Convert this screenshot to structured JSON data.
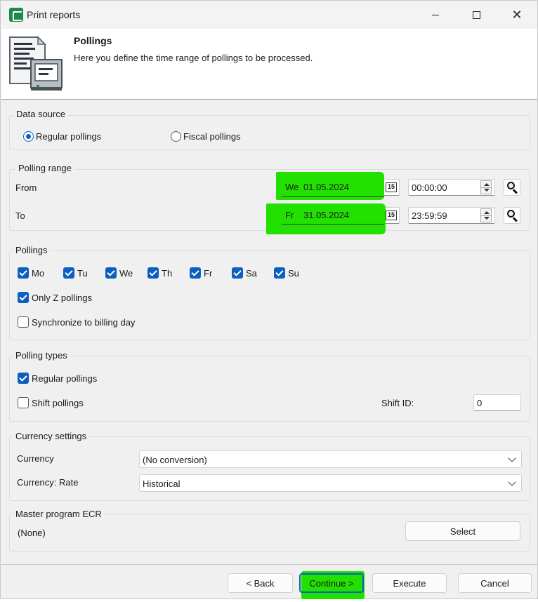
{
  "window": {
    "title": "Print reports"
  },
  "header": {
    "title": "Pollings",
    "subtitle": "Here you define the time range of pollings to be processed."
  },
  "data_source": {
    "title": "Data source",
    "options": [
      {
        "label": "Regular pollings",
        "selected": true
      },
      {
        "label": "Fiscal pollings",
        "selected": false
      }
    ]
  },
  "polling_range": {
    "title": "Polling range",
    "from_label": "From",
    "to_label": "To",
    "from_day": "We",
    "from_date": "01.05.2024",
    "from_time": "00:00:00",
    "to_day": "Fr",
    "to_date": "31.05.2024",
    "to_time": "23:59:59",
    "calendar_glyph": "15",
    "highlight_color": "#22e000"
  },
  "pollings": {
    "title": "Pollings",
    "days": [
      {
        "label": "Mo",
        "checked": true
      },
      {
        "label": "Tu",
        "checked": true
      },
      {
        "label": "We",
        "checked": true
      },
      {
        "label": "Th",
        "checked": true
      },
      {
        "label": "Fr",
        "checked": true
      },
      {
        "label": "Sa",
        "checked": true
      },
      {
        "label": "Su",
        "checked": true
      }
    ],
    "only_z": {
      "label": "Only Z pollings",
      "checked": true
    },
    "sync_billing": {
      "label": "Synchronize to billing day",
      "checked": false
    }
  },
  "polling_types": {
    "title": "Polling types",
    "regular": {
      "label": "Regular pollings",
      "checked": true
    },
    "shift": {
      "label": "Shift pollings",
      "checked": false
    },
    "shift_id_label": "Shift ID:",
    "shift_id_value": "0"
  },
  "currency": {
    "title": "Currency settings",
    "currency_label": "Currency",
    "currency_value": "(No conversion)",
    "rate_label": "Currency: Rate",
    "rate_value": "Historical"
  },
  "master_program": {
    "title": "Master program ECR",
    "value": "(None)",
    "select_label": "Select"
  },
  "footer": {
    "back_label": "< Back",
    "continue_label": "Continue >",
    "execute_label": "Execute",
    "cancel_label": "Cancel"
  },
  "accent_color": "#0a5fbf"
}
